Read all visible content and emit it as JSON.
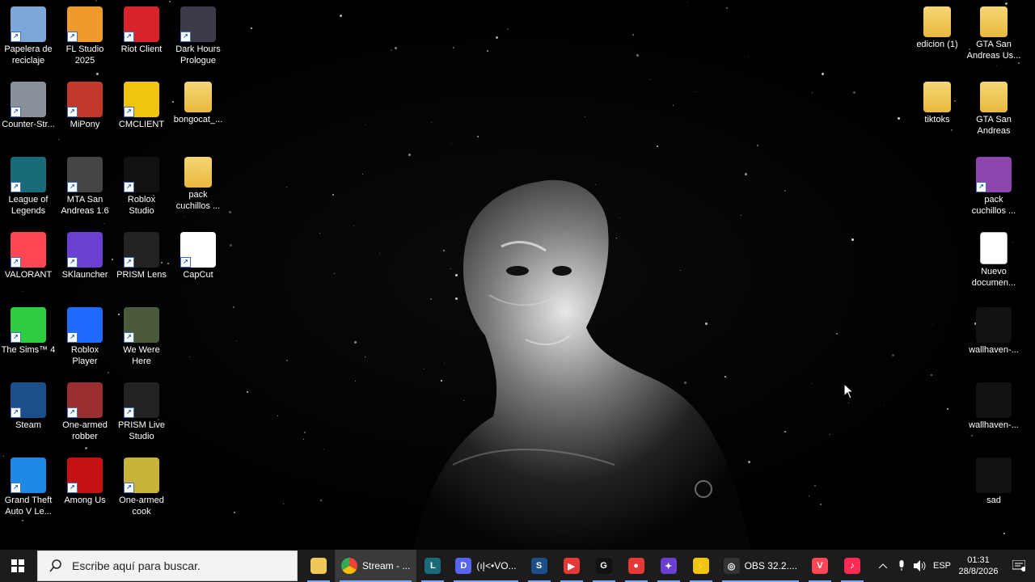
{
  "desktop": {
    "left_icons": [
      {
        "label": "Papelera de reciclaje",
        "icon": "recycle-bin-icon",
        "color": "#7da7d9"
      },
      {
        "label": "FL Studio 2025",
        "icon": "fl-studio-icon",
        "color": "#f09a2b"
      },
      {
        "label": "Riot Client",
        "icon": "riot-client-icon",
        "color": "#d8232a"
      },
      {
        "label": "Dark Hours Prologue",
        "icon": "dark-hours-icon",
        "color": "#3b3b4a"
      },
      {
        "label": "Counter-Str...",
        "icon": "counter-strike-icon",
        "color": "#8a8f9c"
      },
      {
        "label": "MiPony",
        "icon": "mipony-icon",
        "color": "#c0392b"
      },
      {
        "label": "CMCLIENT",
        "icon": "cmclient-icon",
        "color": "#f1c40f"
      },
      {
        "label": "bongocat_...",
        "icon": "folder-icon",
        "color": "#f0c85a"
      },
      {
        "label": "League of Legends",
        "icon": "league-of-legends-icon",
        "color": "#1a6b7a"
      },
      {
        "label": "MTA San Andreas 1.6",
        "icon": "mta-icon",
        "color": "#444"
      },
      {
        "label": "Roblox Studio",
        "icon": "roblox-studio-icon",
        "color": "#111"
      },
      {
        "label": "pack cuchillos ...",
        "icon": "folder-icon",
        "color": "#f0c85a"
      },
      {
        "label": "VALORANT",
        "icon": "valorant-icon",
        "color": "#ff4655"
      },
      {
        "label": "SKlauncher",
        "icon": "sklauncher-icon",
        "color": "#6b3fd1"
      },
      {
        "label": "PRISM Lens",
        "icon": "prism-lens-icon",
        "color": "#222"
      },
      {
        "label": "CapCut",
        "icon": "capcut-icon",
        "color": "#fff"
      },
      {
        "label": "The Sims™ 4",
        "icon": "sims-icon",
        "color": "#2ecc40"
      },
      {
        "label": "Roblox Player",
        "icon": "roblox-player-icon",
        "color": "#1f6bff"
      },
      {
        "label": "We Were Here",
        "icon": "we-were-here-icon",
        "color": "#4b5a3a"
      },
      {
        "label": "Steam",
        "icon": "steam-icon",
        "color": "#1b4f8a"
      },
      {
        "label": "One-armed robber",
        "icon": "one-armed-robber-icon",
        "color": "#9a2f2f"
      },
      {
        "label": "PRISM Live Studio",
        "icon": "prism-live-icon",
        "color": "#222"
      },
      {
        "label": "Grand Theft Auto V Le...",
        "icon": "gta-v-icon",
        "color": "#1e88e5"
      },
      {
        "label": "Among Us",
        "icon": "among-us-icon",
        "color": "#c51111"
      },
      {
        "label": "One-armed cook",
        "icon": "one-armed-cook-icon",
        "color": "#c9b23a"
      }
    ],
    "right_icons": [
      {
        "label": "edicion (1)",
        "icon": "folder-icon",
        "color": "#f0c85a"
      },
      {
        "label": "GTA San Andreas Us...",
        "icon": "folder-icon",
        "color": "#f0c85a"
      },
      {
        "label": "tiktoks",
        "icon": "folder-icon",
        "color": "#f0c85a"
      },
      {
        "label": "GTA San Andreas",
        "icon": "folder-icon",
        "color": "#f0c85a"
      },
      {
        "label": "pack cuchillos ...",
        "icon": "winrar-icon",
        "color": "#8e44ad"
      },
      {
        "label": "Nuevo documen...",
        "icon": "text-document-icon",
        "color": "#ffffff"
      },
      {
        "label": "wallhaven-...",
        "icon": "image-icon",
        "color": "#111"
      },
      {
        "label": "wallhaven-...",
        "icon": "image-icon",
        "color": "#111"
      },
      {
        "label": "sad",
        "icon": "image-icon",
        "color": "#111"
      }
    ]
  },
  "taskbar": {
    "search_placeholder": "Escribe aquí para buscar.",
    "apps": [
      {
        "name": "file-explorer",
        "label": "",
        "color": "#f0c85a",
        "glyph": ""
      },
      {
        "name": "chrome",
        "label": "Stream - ...",
        "color": "#4285f4",
        "glyph": ""
      },
      {
        "name": "league-client",
        "label": "",
        "color": "#1a6b7a",
        "glyph": "L"
      },
      {
        "name": "discord",
        "label": "(ıĮ<•VO...",
        "color": "#5865f2",
        "glyph": "D"
      },
      {
        "name": "steam",
        "label": "",
        "color": "#1b4f8a",
        "glyph": "S"
      },
      {
        "name": "media-player",
        "label": "",
        "color": "#e53935",
        "glyph": "▶"
      },
      {
        "name": "g-hub",
        "label": "",
        "color": "#111",
        "glyph": "G"
      },
      {
        "name": "record-app",
        "label": "",
        "color": "#e53935",
        "glyph": "●"
      },
      {
        "name": "sklauncher",
        "label": "",
        "color": "#6b3fd1",
        "glyph": "✦"
      },
      {
        "name": "cmclient",
        "label": "",
        "color": "#f1c40f",
        "glyph": "⚡"
      },
      {
        "name": "obs",
        "label": "OBS 32.2....",
        "color": "#333",
        "glyph": "◎"
      },
      {
        "name": "valorant",
        "label": "",
        "color": "#ff4655",
        "glyph": "V"
      },
      {
        "name": "tiktok",
        "label": "",
        "color": "#fe2c55",
        "glyph": "♪"
      }
    ],
    "tray": {
      "language": "ESP",
      "time": "01:31",
      "date": "28/8/2026"
    }
  }
}
